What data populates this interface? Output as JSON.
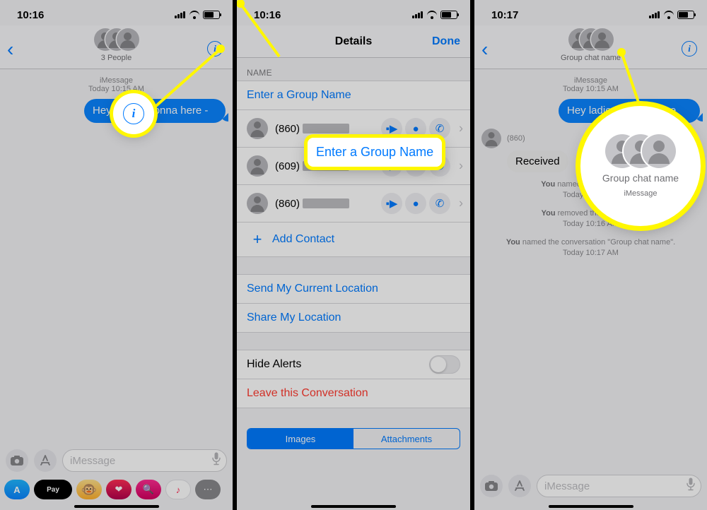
{
  "p1": {
    "time": "10:16",
    "header_subtitle": "3 People",
    "imessage_label": "iMessage",
    "timestamp": "Today 10:15 AM",
    "bubble_text": "Hey ladies Fionna here -",
    "input_placeholder": "iMessage",
    "applepay": "Pay"
  },
  "p2": {
    "time": "10:16",
    "title": "Details",
    "done": "Done",
    "section_name": "NAME",
    "group_name_placeholder": "Enter a Group Name",
    "contacts": [
      {
        "phone": "(860)"
      },
      {
        "phone": "(609)"
      },
      {
        "phone": "(860)"
      }
    ],
    "add_contact": "Add Contact",
    "send_location": "Send My Current Location",
    "share_location": "Share My Location",
    "hide_alerts": "Hide Alerts",
    "leave": "Leave this Conversation",
    "seg_images": "Images",
    "seg_attachments": "Attachments",
    "callout_text": "Enter a Group Name"
  },
  "p3": {
    "time": "10:17",
    "header_subtitle": "Group chat name",
    "imessage_label": "iMessage",
    "timestamp": "Today 10:15 AM",
    "bubble_text": "Hey ladies Fionna here",
    "sender_num": "(860)",
    "received": "Received",
    "sys1_a": "You",
    "sys1_b": " named the conversation",
    "sys1_time": "Today 10:15 AM",
    "sys2_a": "You",
    "sys2_b": " removed the name from",
    "sys2_time": "Today 10:16 AM",
    "sys3_a": "You",
    "sys3_b": " named the conversation \"Group chat name\".",
    "sys3_time": "Today 10:17 AM",
    "input_placeholder": "iMessage",
    "callout_caption": "Group chat name",
    "callout_sub": "iMessage"
  }
}
